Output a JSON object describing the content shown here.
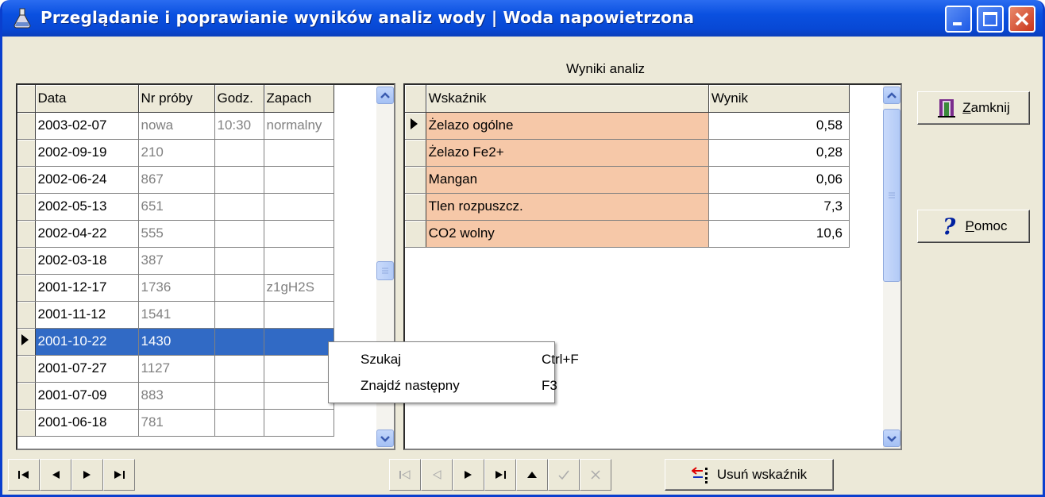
{
  "window": {
    "title": "Przeglądanie i poprawianie wyników analiz wody | Woda napowietrzona"
  },
  "caption": "Wyniki analiz",
  "samples": {
    "columns": [
      "Data",
      "Nr próby",
      "Godz.",
      "Zapach"
    ],
    "rows": [
      [
        "2003-02-07",
        "nowa",
        "10:30",
        "normalny"
      ],
      [
        "2002-09-19",
        "210",
        "",
        ""
      ],
      [
        "2002-06-24",
        "867",
        "",
        ""
      ],
      [
        "2002-05-13",
        "651",
        "",
        ""
      ],
      [
        "2002-04-22",
        "555",
        "",
        ""
      ],
      [
        "2002-03-18",
        "387",
        "",
        ""
      ],
      [
        "2001-12-17",
        "1736",
        "",
        "z1gH2S"
      ],
      [
        "2001-11-12",
        "1541",
        "",
        ""
      ],
      [
        "2001-10-22",
        "1430",
        "",
        ""
      ],
      [
        "2001-07-27",
        "1127",
        "",
        ""
      ],
      [
        "2001-07-09",
        "883",
        "",
        ""
      ],
      [
        "2001-06-18",
        "781",
        "",
        ""
      ]
    ],
    "selected_index": 8
  },
  "results": {
    "columns": [
      "Wskaźnik",
      "Wynik"
    ],
    "rows": [
      [
        "Żelazo ogólne",
        "0,58"
      ],
      [
        "Żelazo Fe2+",
        "0,28"
      ],
      [
        "Mangan",
        "0,06"
      ],
      [
        "Tlen rozpuszcz.",
        "7,3"
      ],
      [
        "CO2 wolny",
        "10,6"
      ]
    ],
    "current_index": 0
  },
  "buttons": {
    "close": "Zamknij",
    "help": "Pomoc",
    "delete_indicator": "Usuń wskaźnik"
  },
  "context_menu": {
    "items": [
      {
        "label": "Szukaj",
        "shortcut": "Ctrl+F"
      },
      {
        "label": "Znajdź następny",
        "shortcut": "F3"
      }
    ]
  },
  "colors": {
    "selection": "#316ac5",
    "indicator_cell": "#f6c8a8"
  }
}
